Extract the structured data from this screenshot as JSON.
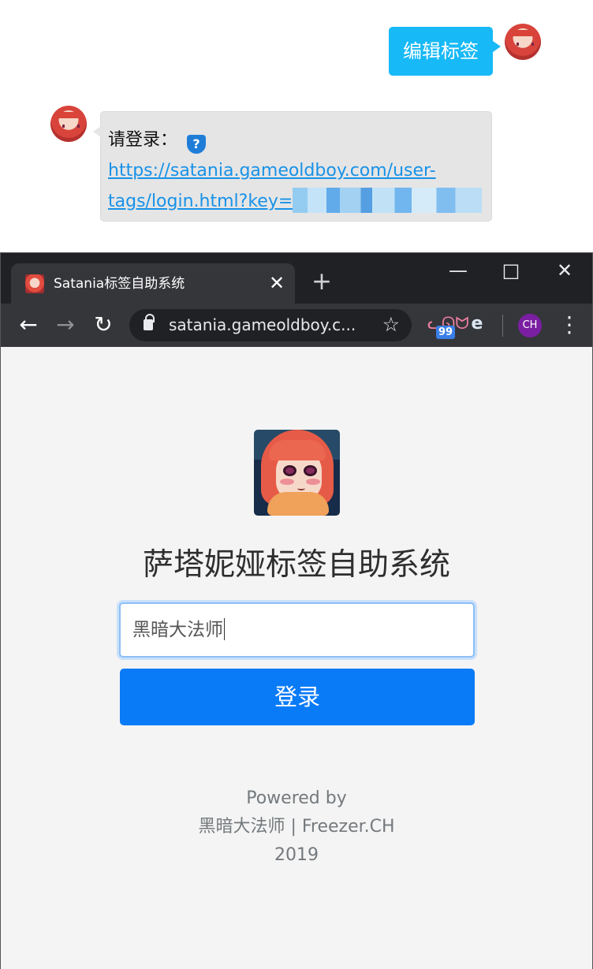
{
  "chat": {
    "right_bubble": "编辑标签",
    "left_prompt": "请登录：",
    "link_line_1": "https://satania.gameoldboy.com/user-",
    "link_line_2": "tags/login.html?key="
  },
  "browser": {
    "tab_title": "Satania标签自助系统",
    "tab_close": "✕",
    "new_tab": "+",
    "window_controls": {
      "minimize": "—",
      "maximize": "□",
      "close": "✕"
    },
    "nav": {
      "back": "←",
      "forward": "→",
      "reload": "↻",
      "star": "☆",
      "menu": "⋮"
    },
    "address_text": "satania.gameoldboy.c...",
    "extensions": {
      "cat_icon": "ᓚᘏᗢ",
      "badge": "99",
      "edge_icon": "e",
      "profile": "CH"
    }
  },
  "login_page": {
    "title": "萨塔妮娅标签自助系统",
    "input_value": "黑暗大法师",
    "button_label": "登录",
    "footer": [
      "Powered by",
      "黑暗大法师 | Freezer.CH",
      "2019"
    ]
  },
  "colors": {
    "chat_accent": "#17b9f7",
    "link": "#1792e8",
    "primary_button": "#0a7bf7",
    "browser_chrome": "#202124"
  }
}
